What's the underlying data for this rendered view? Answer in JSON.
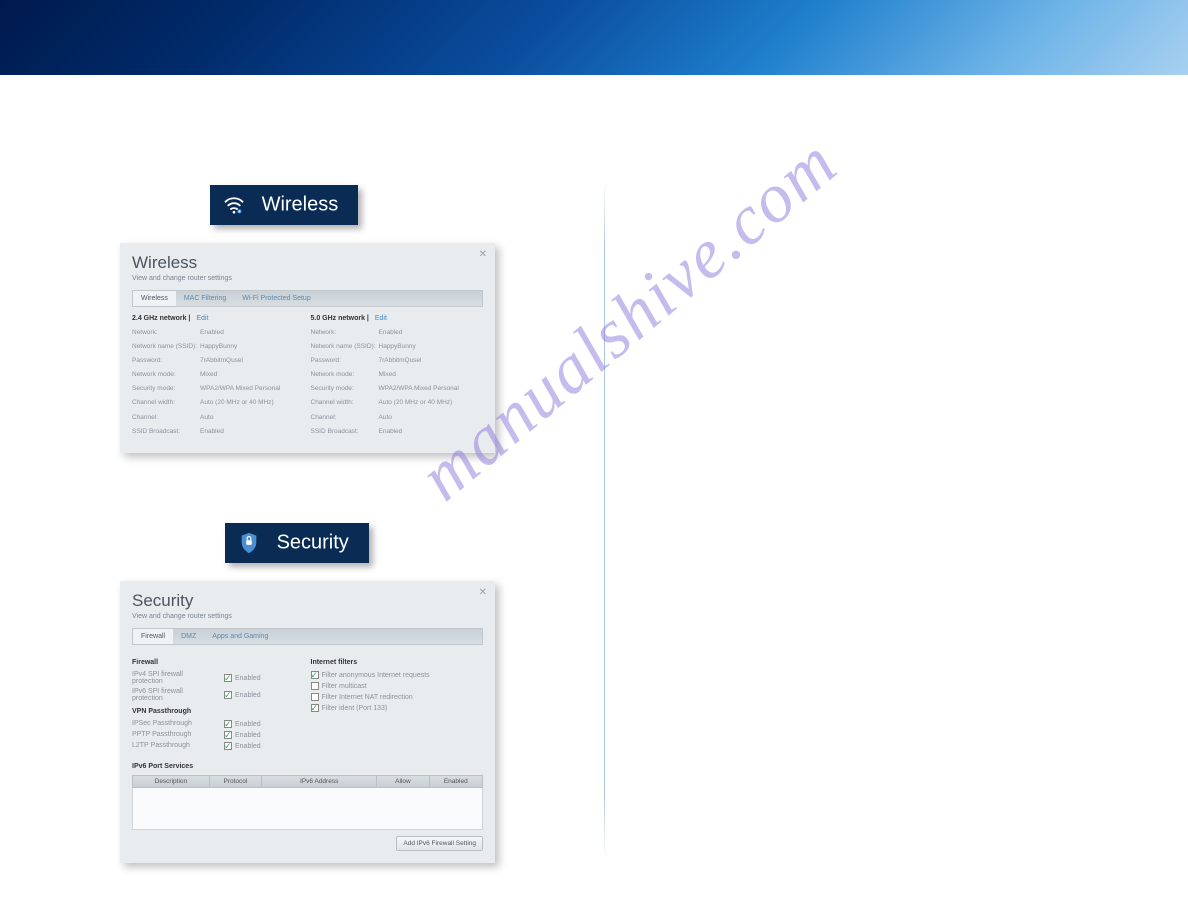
{
  "watermark": "manualshive.com",
  "wireless": {
    "tab_label": "Wireless",
    "panel_title": "Wireless",
    "panel_sub": "View and change router settings",
    "tabs": [
      "Wireless",
      "MAC Filtering",
      "Wi-Fi Protected Setup"
    ],
    "n24": {
      "header": "2.4 GHz network",
      "edit": "Edit",
      "rows": [
        {
          "k": "Network:",
          "v": "Enabled"
        },
        {
          "k": "Network name (SSID):",
          "v": "HappyBunny"
        },
        {
          "k": "Password:",
          "v": "7rAbbitmQusel"
        },
        {
          "k": "Network mode:",
          "v": "Mixed"
        },
        {
          "k": "Security mode:",
          "v": "WPA2/WPA Mixed Personal"
        },
        {
          "k": "Channel width:",
          "v": "Auto (20 MHz or 40 MHz)"
        },
        {
          "k": "Channel:",
          "v": "Auto"
        },
        {
          "k": "SSID Broadcast:",
          "v": "Enabled"
        }
      ]
    },
    "n50": {
      "header": "5.0 GHz network",
      "edit": "Edit",
      "rows": [
        {
          "k": "Network:",
          "v": "Enabled"
        },
        {
          "k": "Network name (SSID):",
          "v": "HappyBunny"
        },
        {
          "k": "Password:",
          "v": "7rAbbitmQusel"
        },
        {
          "k": "Network mode:",
          "v": "Mixed"
        },
        {
          "k": "Security mode:",
          "v": "WPA2/WPA Mixed Personal"
        },
        {
          "k": "Channel width:",
          "v": "Auto (20 MHz or 40 MHz)"
        },
        {
          "k": "Channel:",
          "v": "Auto"
        },
        {
          "k": "SSID Broadcast:",
          "v": "Enabled"
        }
      ]
    }
  },
  "security": {
    "tab_label": "Security",
    "panel_title": "Security",
    "panel_sub": "View and change router settings",
    "tabs": [
      "Firewall",
      "DMZ",
      "Apps and Gaming"
    ],
    "firewall": {
      "title": "Firewall",
      "rows": [
        {
          "label": "IPv4 SPI firewall protection",
          "checked": true,
          "text": "Enabled"
        },
        {
          "label": "IPv6 SPI firewall protection",
          "checked": true,
          "text": "Enabled"
        }
      ]
    },
    "vpn": {
      "title": "VPN Passthrough",
      "rows": [
        {
          "label": "IPSec Passthrough",
          "checked": true,
          "text": "Enabled"
        },
        {
          "label": "PPTP Passthrough",
          "checked": true,
          "text": "Enabled"
        },
        {
          "label": "L2TP Passthrough",
          "checked": true,
          "text": "Enabled"
        }
      ]
    },
    "filters": {
      "title": "Internet filters",
      "rows": [
        {
          "checked": true,
          "text": "Filter anonymous Internet requests"
        },
        {
          "checked": false,
          "text": "Filter multicast"
        },
        {
          "checked": false,
          "text": "Filter Internet NAT redirection"
        },
        {
          "checked": true,
          "text": "Filter ident (Port 133)"
        }
      ]
    },
    "ipv6": {
      "title": "IPv6 Port Services",
      "cols": [
        "Description",
        "Protocol",
        "IPv6 Address",
        "Allow",
        "Enabled"
      ],
      "add_btn": "Add IPv6 Firewall Setting"
    }
  }
}
